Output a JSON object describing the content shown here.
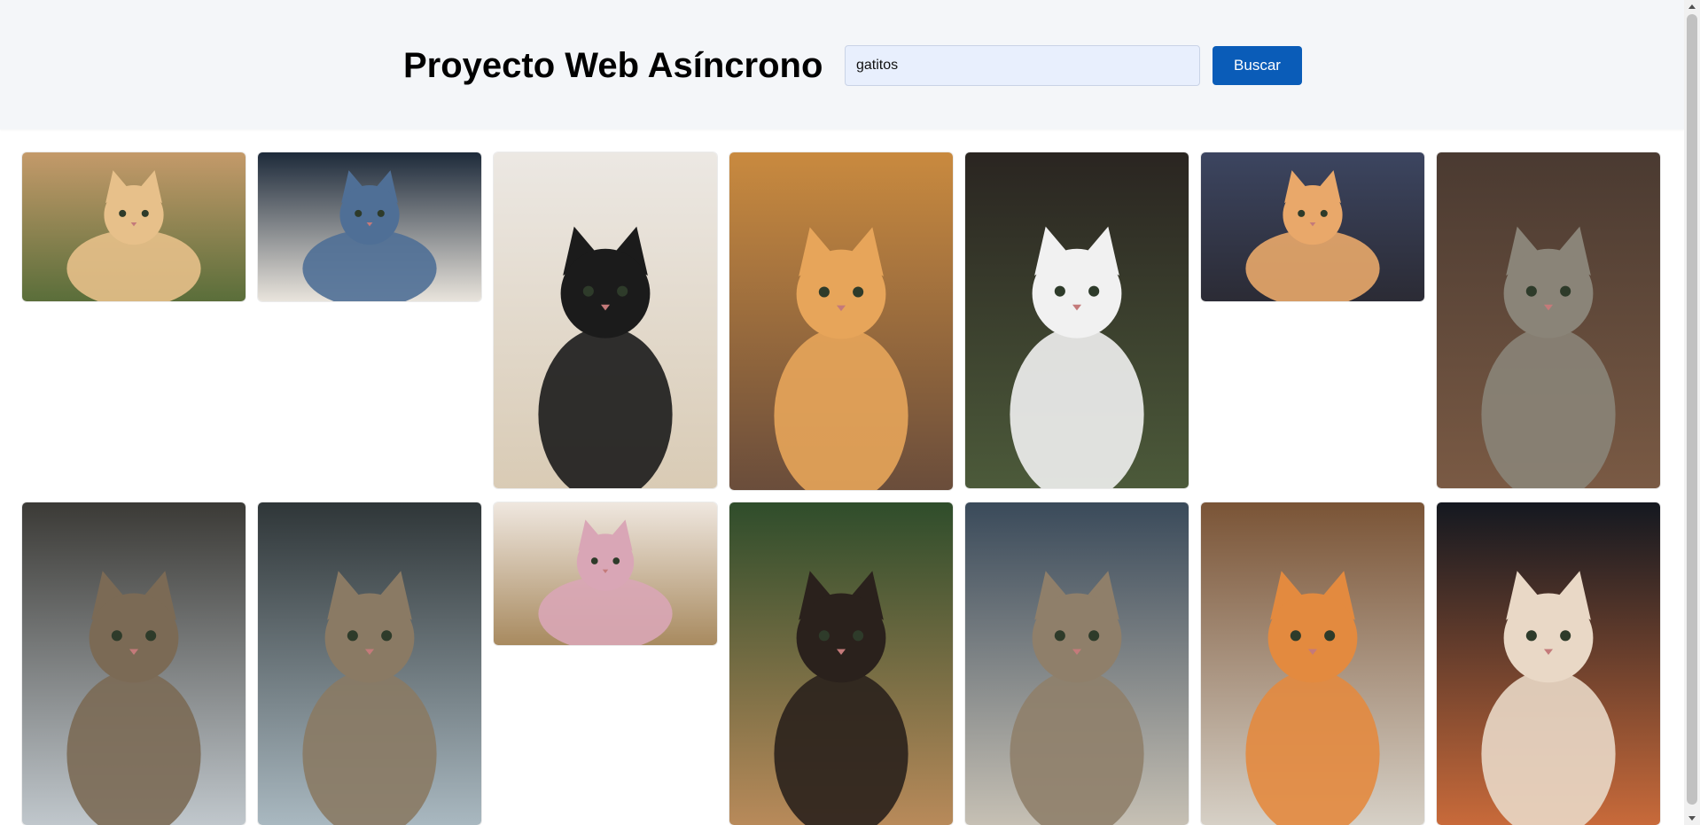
{
  "header": {
    "title": "Proyecto Web Asíncrono",
    "search_value": "gatitos",
    "search_button": "Buscar"
  },
  "gallery": {
    "images": [
      {
        "name": "orange-tabby-lying",
        "bg": "#c49a6a",
        "fg": "#e7c08a",
        "accent": "#5a6e3a"
      },
      {
        "name": "cat-under-car",
        "bg": "#1d2a3a",
        "fg": "#4f6f96",
        "accent": "#e9e4dc"
      },
      {
        "name": "black-white-kitten-paper",
        "bg": "#ece8e3",
        "fg": "#1b1b1b",
        "accent": "#d9cbb5"
      },
      {
        "name": "orange-kitten-steps",
        "bg": "#c98a3f",
        "fg": "#e7a55a",
        "accent": "#6a4d3b"
      },
      {
        "name": "white-black-kitten-garden",
        "bg": "#2a2521",
        "fg": "#f1f1f1",
        "accent": "#4c5a3a"
      },
      {
        "name": "orange-cat-cushion",
        "bg": "#3c4560",
        "fg": "#e9a86a",
        "accent": "#2b2b35"
      },
      {
        "name": "gray-kitten-box",
        "bg": "#4a3a31",
        "fg": "#8a8478",
        "accent": "#7a5a44"
      },
      {
        "name": "tabby-cat-lying",
        "bg": "#3b3a36",
        "fg": "#7b6a55",
        "accent": "#c0c7cc"
      },
      {
        "name": "tabby-cat-closeup",
        "bg": "#2f3638",
        "fg": "#8a7a64",
        "accent": "#a9b8c0"
      },
      {
        "name": "kitten-flowers-basket",
        "bg": "#efe7df",
        "fg": "#d9a6b6",
        "accent": "#a88a5f"
      },
      {
        "name": "tortoiseshell-kitten",
        "bg": "#2f4d2b",
        "fg": "#2a211c",
        "accent": "#b88a5a"
      },
      {
        "name": "tabby-cat-portrait",
        "bg": "#3a4a5a",
        "fg": "#8f7f6a",
        "accent": "#c6c0b4"
      },
      {
        "name": "orange-kitten-ledge",
        "bg": "#7a5436",
        "fg": "#e38a3f",
        "accent": "#d6d0c6"
      },
      {
        "name": "white-orange-cat-night",
        "bg": "#141820",
        "fg": "#e9d8c6",
        "accent": "#c86a3a"
      }
    ]
  }
}
